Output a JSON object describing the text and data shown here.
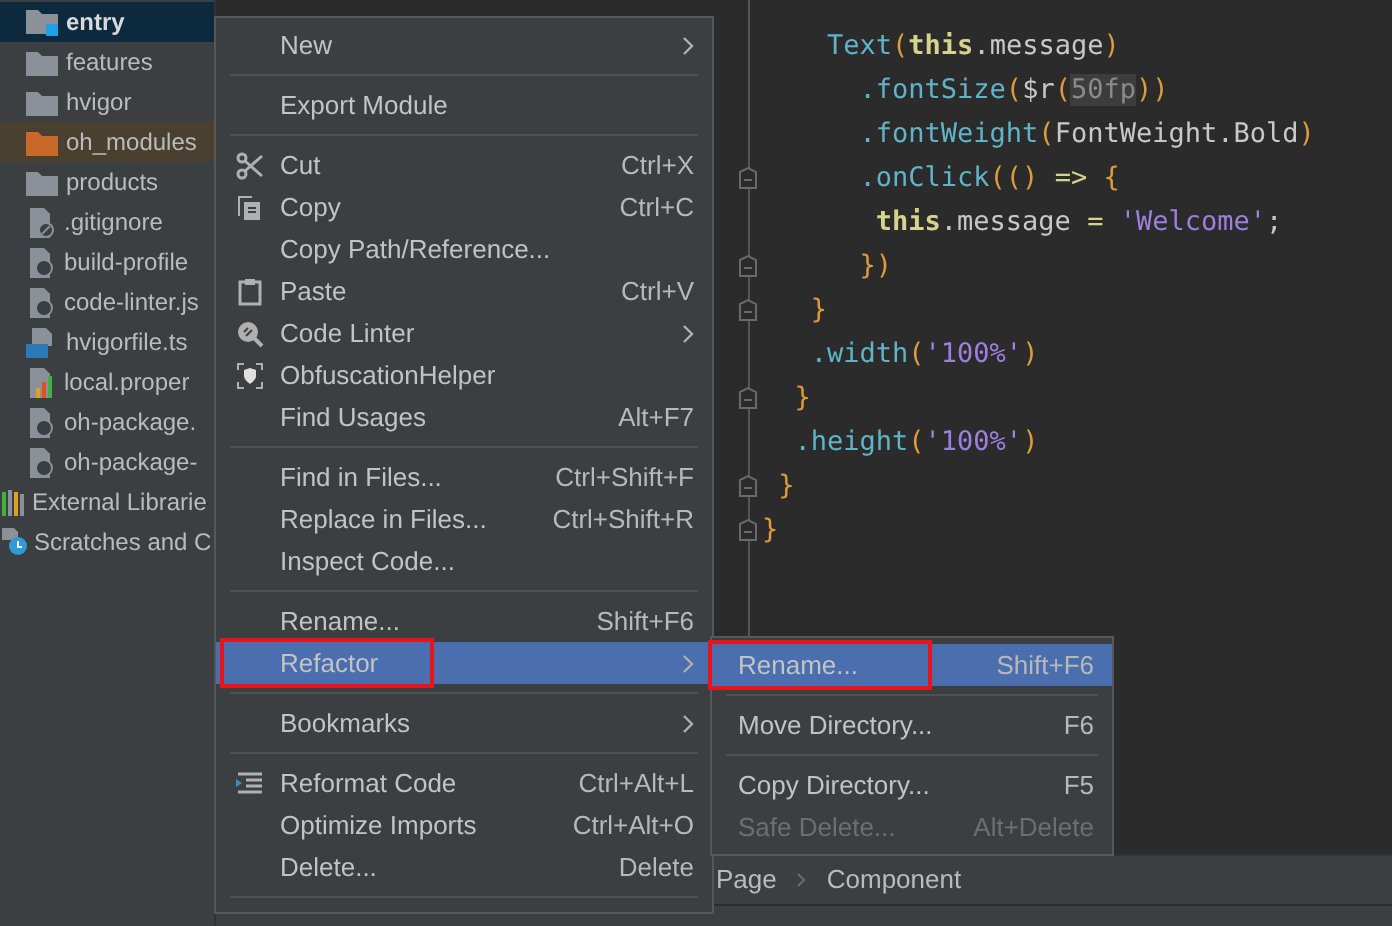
{
  "project_tree": [
    {
      "name": "entry",
      "kind": "module",
      "selected": true,
      "excluded": false
    },
    {
      "name": "features",
      "kind": "folder",
      "selected": false,
      "excluded": false
    },
    {
      "name": "hvigor",
      "kind": "folder",
      "selected": false,
      "excluded": false
    },
    {
      "name": "oh_modules",
      "kind": "folder",
      "selected": false,
      "excluded": true
    },
    {
      "name": "products",
      "kind": "folder",
      "selected": false,
      "excluded": false
    },
    {
      "name": ".gitignore",
      "kind": "ignore",
      "selected": false,
      "excluded": false
    },
    {
      "name": "build-profile",
      "kind": "config",
      "selected": false,
      "excluded": false
    },
    {
      "name": "code-linter.js",
      "kind": "config",
      "selected": false,
      "excluded": false
    },
    {
      "name": "hvigorfile.ts",
      "kind": "typescript",
      "selected": false,
      "excluded": false
    },
    {
      "name": "local.proper",
      "kind": "properties",
      "selected": false,
      "excluded": false
    },
    {
      "name": "oh-package.",
      "kind": "config",
      "selected": false,
      "excluded": false
    },
    {
      "name": "oh-package-",
      "kind": "config",
      "selected": false,
      "excluded": false
    }
  ],
  "tree_roots": [
    {
      "name": "External Librarie",
      "kind": "libraries"
    },
    {
      "name": "Scratches and C",
      "kind": "scratches"
    }
  ],
  "code_lines": [
    {
      "fold": false,
      "tokens": [
        {
          "text": "    Text",
          "kind": "fn"
        },
        {
          "text": "(",
          "kind": "punct"
        },
        {
          "text": "this",
          "kind": "kw"
        },
        {
          "text": ".message",
          "kind": "plain"
        },
        {
          "text": ")",
          "kind": "punct"
        }
      ]
    },
    {
      "fold": false,
      "tokens": [
        {
          "text": "      .fontSize",
          "kind": "fn"
        },
        {
          "text": "(",
          "kind": "punct"
        },
        {
          "text": "$r",
          "kind": "plain"
        },
        {
          "text": "(",
          "kind": "punct"
        },
        {
          "text": "50fp",
          "kind": "dim"
        },
        {
          "text": "))",
          "kind": "punct"
        }
      ]
    },
    {
      "fold": false,
      "tokens": [
        {
          "text": "      .fontWeight",
          "kind": "fn"
        },
        {
          "text": "(",
          "kind": "punct"
        },
        {
          "text": "FontWeight.Bold",
          "kind": "plain"
        },
        {
          "text": ")",
          "kind": "punct"
        }
      ]
    },
    {
      "fold": true,
      "tokens": [
        {
          "text": "      .onClick",
          "kind": "fn"
        },
        {
          "text": "(() ",
          "kind": "punct"
        },
        {
          "text": "=> ",
          "kind": "op"
        },
        {
          "text": "{",
          "kind": "punct"
        }
      ]
    },
    {
      "fold": false,
      "tokens": [
        {
          "text": "       this",
          "kind": "kw"
        },
        {
          "text": ".message ",
          "kind": "plain"
        },
        {
          "text": "= ",
          "kind": "op"
        },
        {
          "text": "'Welcome'",
          "kind": "str"
        },
        {
          "text": ";",
          "kind": "plain"
        }
      ]
    },
    {
      "fold": true,
      "tokens": [
        {
          "text": "      })",
          "kind": "punct"
        }
      ]
    },
    {
      "fold": true,
      "tokens": [
        {
          "text": "   }",
          "kind": "punct"
        }
      ]
    },
    {
      "fold": false,
      "tokens": [
        {
          "text": "   .width",
          "kind": "fn"
        },
        {
          "text": "(",
          "kind": "punct"
        },
        {
          "text": "'100%'",
          "kind": "str"
        },
        {
          "text": ")",
          "kind": "punct"
        }
      ]
    },
    {
      "fold": true,
      "tokens": [
        {
          "text": "  }",
          "kind": "punct"
        }
      ]
    },
    {
      "fold": false,
      "tokens": [
        {
          "text": "  .height",
          "kind": "fn"
        },
        {
          "text": "(",
          "kind": "punct"
        },
        {
          "text": "'100%'",
          "kind": "str"
        },
        {
          "text": ")",
          "kind": "punct"
        }
      ]
    },
    {
      "fold": true,
      "tokens": [
        {
          "text": " }",
          "kind": "punct"
        }
      ]
    },
    {
      "fold": true,
      "tokens": [
        {
          "text": "}",
          "kind": "punct"
        }
      ]
    }
  ],
  "breadcrumb": [
    "Page",
    "Component"
  ],
  "context_menu": [
    {
      "kind": "item",
      "label": "New",
      "submenu": true,
      "selected": false
    },
    {
      "kind": "separator"
    },
    {
      "kind": "item",
      "label": "Export Module",
      "selected": false
    },
    {
      "kind": "separator"
    },
    {
      "kind": "scissors-item",
      "label": "Cut",
      "shortcut": "Ctrl+X",
      "selected": false
    },
    {
      "kind": "copy-item",
      "label": "Copy",
      "shortcut": "Ctrl+C",
      "selected": false
    },
    {
      "kind": "item",
      "label": "Copy Path/Reference...",
      "selected": false
    },
    {
      "kind": "clipboard-item",
      "label": "Paste",
      "shortcut": "Ctrl+V",
      "selected": false
    },
    {
      "kind": "linter-item",
      "label": "Code Linter",
      "submenu": true,
      "selected": false
    },
    {
      "kind": "shield-item",
      "label": "ObfuscationHelper",
      "selected": false
    },
    {
      "kind": "item",
      "label": "Find Usages",
      "shortcut": "Alt+F7",
      "selected": false
    },
    {
      "kind": "separator"
    },
    {
      "kind": "item",
      "label": "Find in Files...",
      "shortcut": "Ctrl+Shift+F",
      "selected": false
    },
    {
      "kind": "item",
      "label": "Replace in Files...",
      "shortcut": "Ctrl+Shift+R",
      "selected": false
    },
    {
      "kind": "item",
      "label": "Inspect Code...",
      "selected": false
    },
    {
      "kind": "separator"
    },
    {
      "kind": "item",
      "label": "Rename...",
      "shortcut": "Shift+F6",
      "selected": false
    },
    {
      "kind": "item",
      "label": "Refactor",
      "submenu": true,
      "selected": true,
      "annotated": true
    },
    {
      "kind": "separator"
    },
    {
      "kind": "item",
      "label": "Bookmarks",
      "submenu": true,
      "selected": false
    },
    {
      "kind": "separator"
    },
    {
      "kind": "reformat-item",
      "label": "Reformat Code",
      "shortcut": "Ctrl+Alt+L",
      "selected": false
    },
    {
      "kind": "item",
      "label": "Optimize Imports",
      "shortcut": "Ctrl+Alt+O",
      "selected": false
    },
    {
      "kind": "item",
      "label": "Delete...",
      "shortcut": "Delete",
      "selected": false
    },
    {
      "kind": "separator"
    }
  ],
  "refactor_submenu": [
    {
      "kind": "item",
      "label": "Rename...",
      "shortcut": "Shift+F6",
      "selected": true,
      "annotated": true,
      "disabled": false
    },
    {
      "kind": "separator"
    },
    {
      "kind": "item",
      "label": "Move Directory...",
      "shortcut": "F6",
      "selected": false,
      "disabled": false
    },
    {
      "kind": "separator"
    },
    {
      "kind": "item",
      "label": "Copy Directory...",
      "shortcut": "F5",
      "selected": false,
      "disabled": false
    },
    {
      "kind": "item",
      "label": "Safe Delete...",
      "shortcut": "Alt+Delete",
      "selected": false,
      "disabled": true
    }
  ]
}
